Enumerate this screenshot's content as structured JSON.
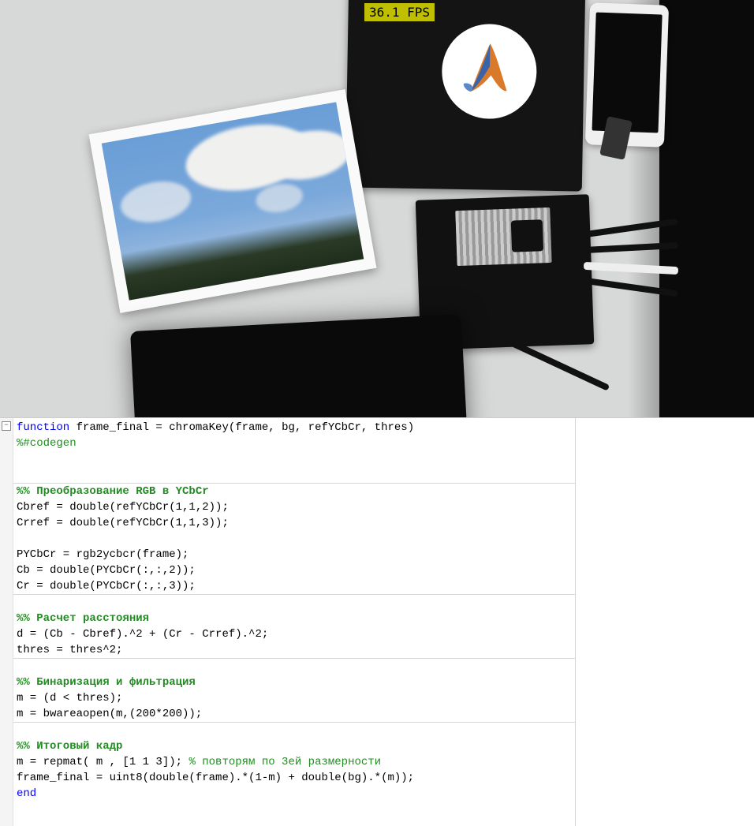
{
  "video": {
    "fps_text": "36.1 FPS"
  },
  "code": {
    "l01_kw1": "function",
    "l01_rest": " frame_final = chromaKey(frame, bg, refYCbCr, thres)",
    "l02": "%#codegen",
    "l05_sec": "%% Преобразование RGB в YCbCr",
    "l06": "Cbref = double(refYCbCr(1,1,2));",
    "l07": "Crref = double(refYCbCr(1,1,3));",
    "l09": "PYCbCr = rgb2ycbcr(frame);",
    "l10": "Cb = double(PYCbCr(:,:,2));",
    "l11": "Cr = double(PYCbCr(:,:,3));",
    "l13_sec": "%% Расчет расстояния",
    "l14": "d = (Cb - Cbref).^2 + (Cr - Crref).^2;",
    "l15": "thres = thres^2;",
    "l17_sec": "%% Бинаризация и фильтрация",
    "l18": "m = (d < thres);",
    "l19": "m = bwareaopen(m,(200*200));",
    "l21_sec": "%% Итоговый кадр",
    "l22a": "m = repmat( m , [1 1 3]); ",
    "l22b": "% повторям по 3ей размерности",
    "l23": "frame_final = uint8(double(frame).*(1-m) + double(bg).*(m));",
    "l24_kw": "end"
  }
}
